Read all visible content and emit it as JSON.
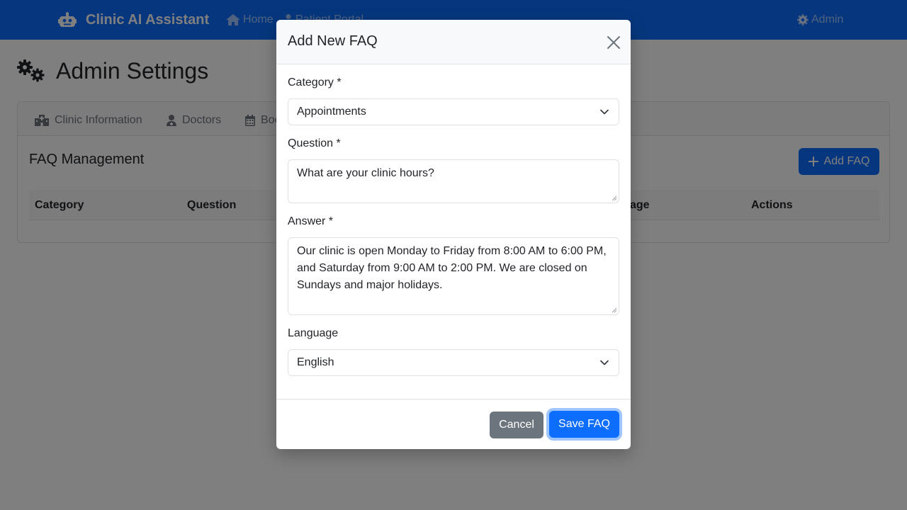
{
  "navbar": {
    "brand": "Clinic AI Assistant",
    "links": {
      "home": "Home",
      "patient_portal": "Patient Portal",
      "admin": "Admin"
    },
    "color": "#0d6efd"
  },
  "page": {
    "title": "Admin Settings",
    "tabs": {
      "clinic_info": "Clinic Information",
      "doctors": "Doctors",
      "booking": "Booking"
    },
    "section_title": "FAQ Management",
    "add_faq_label": "Add FAQ",
    "table_headers": {
      "category": "Category",
      "question": "Question",
      "language": "Language",
      "actions": "Actions"
    }
  },
  "modal": {
    "title": "Add New FAQ",
    "category": {
      "label": "Category *",
      "value": "Appointments"
    },
    "question": {
      "label": "Question *",
      "value": "What are your clinic hours?"
    },
    "answer": {
      "label": "Answer *",
      "value": "Our clinic is open Monday to Friday from 8:00 AM to 6:00 PM,\nand Saturday from 9:00 AM to 2:00 PM. We are closed on\nSundays and major holidays."
    },
    "language": {
      "label": "Language",
      "value": "English"
    },
    "cancel_label": "Cancel",
    "save_label": "Save FAQ"
  },
  "icons": {
    "brand": "robot-icon",
    "home": "house-icon",
    "portal": "person-icon",
    "admin": "gear-icon",
    "title": "gears-icon",
    "clinic": "hospital-icon",
    "doctors": "doctor-icon",
    "booking": "calendar-icon",
    "add": "plus-icon",
    "close": "close-icon",
    "dropdown": "chevron-down-icon"
  }
}
